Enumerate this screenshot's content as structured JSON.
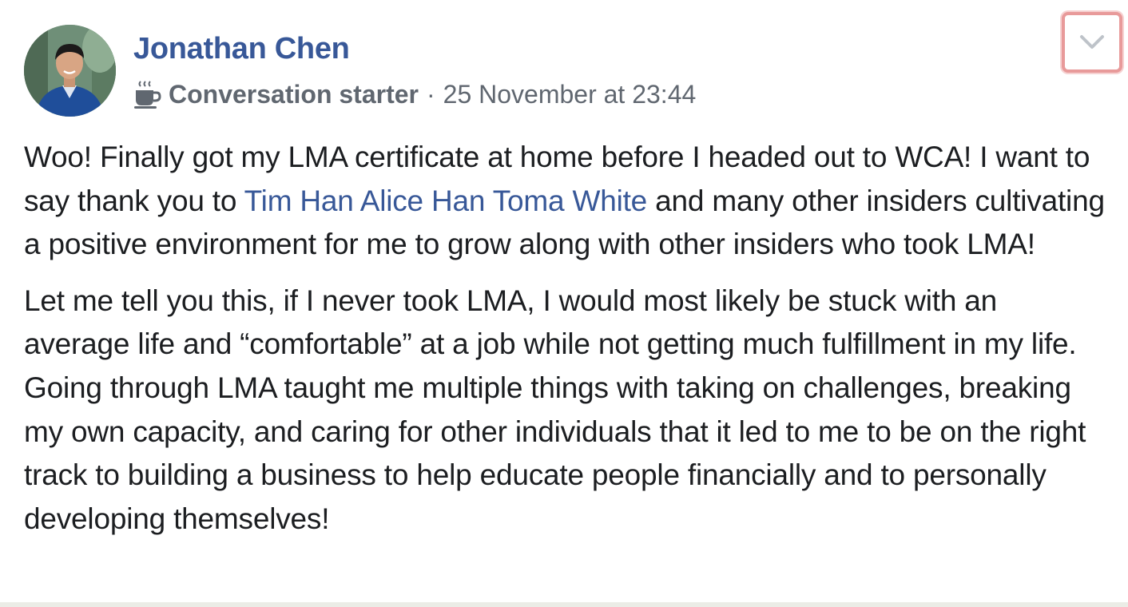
{
  "post": {
    "author": "Jonathan Chen",
    "badge": {
      "icon": "coffee-cup-icon",
      "label": "Conversation starter"
    },
    "separator": "·",
    "timestamp": "25 November at 23:44",
    "menu_icon": "chevron-down-icon",
    "paragraph1": {
      "text_before": "Woo! Finally got my LMA certificate at home before I headed out to WCA! I want to say thank you to ",
      "mentions": [
        "Tim Han",
        "Alice Han",
        "Toma White"
      ],
      "text_after": " and many other insiders cultivating a positive environment for me to grow along with other insiders who took LMA!"
    },
    "paragraph2": "Let me tell you this, if I never took LMA, I would most likely be stuck with an average life and “comfortable” at a job while not getting much fulfillment in my life. Going through LMA taught me multiple things with taking on challenges, breaking my own capacity, and caring for other individuals that it led to me to be on the right track to building a business to help educate people financially and to personally developing themselves!"
  },
  "colors": {
    "link": "#385898",
    "meta": "#606770",
    "text": "#1c1e21",
    "highlight_border": "#e89a9a"
  }
}
